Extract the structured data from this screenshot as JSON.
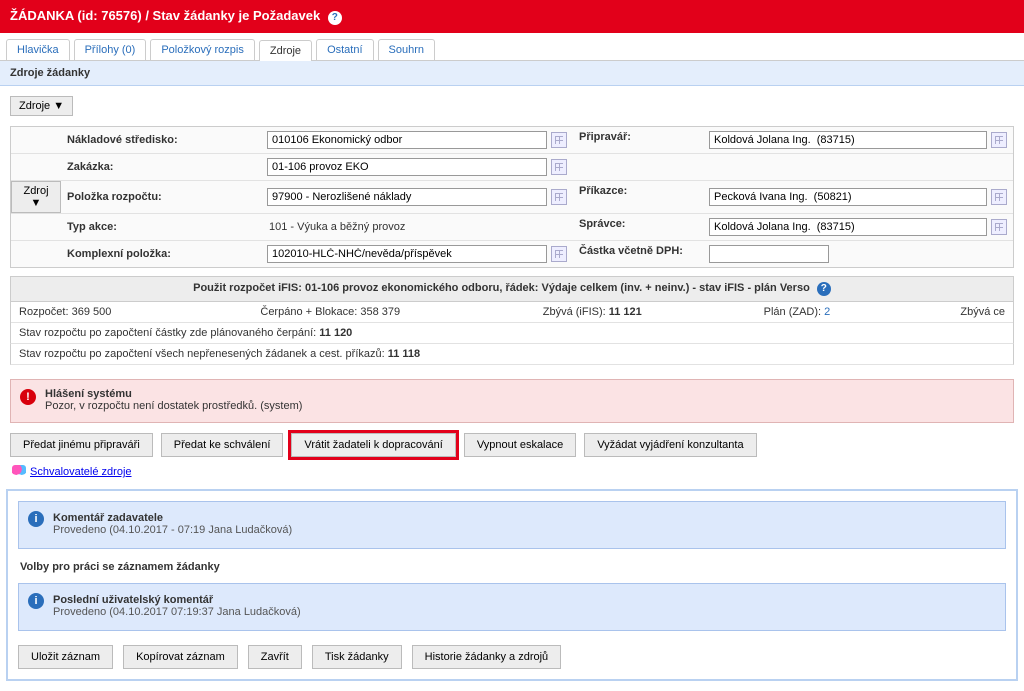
{
  "header": {
    "title": "ŽÁDANKA (id: 76576) / Stav žádanky je Požadavek"
  },
  "tabs": {
    "items": [
      {
        "label": "Hlavička"
      },
      {
        "label": "Přílohy (0)"
      },
      {
        "label": "Položkový rozpis"
      },
      {
        "label": "Zdroje"
      },
      {
        "label": "Ostatní"
      },
      {
        "label": "Souhrn"
      }
    ],
    "active_index": 3
  },
  "subheader": "Zdroje žádanky",
  "buttons": {
    "zdroje_menu": "Zdroje ▼",
    "zdroj_menu": "Zdroj ▼"
  },
  "form": {
    "nakladove_stredisko_label": "Nákladové středisko:",
    "nakladove_stredisko_value": "010106 Ekonomický odbor",
    "zakazka_label": "Zakázka:",
    "zakazka_value": "01-106 provoz EKO",
    "polozka_label": "Položka rozpočtu:",
    "polozka_value": "97900 - Nerozlišené náklady",
    "typ_akce_label": "Typ akce:",
    "typ_akce_value": "101 - Výuka a běžný provoz",
    "komplexni_label": "Komplexní položka:",
    "komplexni_value": "102010-HLČ-NHČ/nevěda/příspěvek",
    "pripravar_label": "Připravář:",
    "pripravar_value": "Koldová Jolana Ing.  (83715)",
    "prikazce_label": "Příkazce:",
    "prikazce_value": "Pecková Ivana Ing.  (50821)",
    "spravce_label": "Správce:",
    "spravce_value": "Koldová Jolana Ing.  (83715)",
    "castka_label": "Částka včetně DPH:",
    "castka_value": ""
  },
  "budget_title": "Použit rozpočet iFIS: 01-106 provoz ekonomického odboru, řádek: Výdaje celkem (inv. + neinv.) - stav iFIS - plán Verso",
  "budget": {
    "rozpocet_label": "Rozpočet:",
    "rozpocet_value": "369 500",
    "cerpano_label": "Čerpáno + Blokace:",
    "cerpano_value": "358 379",
    "zbyva_label": "Zbývá (iFIS):",
    "zbyva_value": "11 121",
    "plan_label": "Plán (ZAD):",
    "plan_value": "2",
    "zbyva_ce_label": "Zbývá ce"
  },
  "stav1_prefix": "Stav rozpočtu po započtení částky zde plánovaného čerpání:",
  "stav1_value": "11 120",
  "stav2_prefix": "Stav rozpočtu po započtení všech nepřenesených žádanek a cest. příkazů:",
  "stav2_value": "11 118",
  "alert": {
    "title": "Hlášení systému",
    "body": "Pozor, v rozpočtu není dostatek prostředků. (system)"
  },
  "action_buttons": {
    "predat_jinemu": "Předat jinému připraváři",
    "predat_schvaleni": "Předat ke schválení",
    "vratit": "Vrátit žadateli k dopracování",
    "vypnout": "Vypnout eskalace",
    "vyzadat": "Vyžádat vyjádření konzultanta"
  },
  "schvalovatele_link": "Schvalovatelé zdroje",
  "comment1": {
    "title": "Komentář zadavatele",
    "sub": "Provedeno (04.10.2017 - 07:19 Jana Ludačková)"
  },
  "section_volby": "Volby pro práci se záznamem žádanky",
  "comment2": {
    "title": "Poslední uživatelský komentář",
    "sub": "Provedeno (04.10.2017 07:19:37 Jana Ludačková)"
  },
  "bottom_buttons": {
    "ulozit": "Uložit záznam",
    "kopirovat": "Kopírovat záznam",
    "zavrit": "Zavřít",
    "tisk": "Tisk žádanky",
    "historie": "Historie žádanky a zdrojů"
  }
}
